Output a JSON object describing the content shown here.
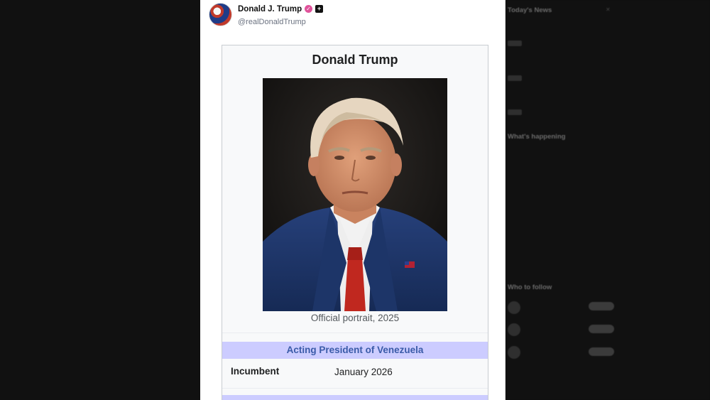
{
  "post": {
    "author": {
      "display_name": "Donald J. Trump",
      "handle": "@realDonaldTrump",
      "badge_icon": "verified-badge-icon",
      "badge_color": "#e0539b",
      "extra_icon": "plus-square-icon"
    },
    "infobox": {
      "title": "Donald Trump",
      "caption": "Official portrait, 2025",
      "office_title": "Acting President of Venezuela",
      "office_header_color": "#ccccff",
      "rows": [
        {
          "label": "Incumbent",
          "value": "January 2026"
        }
      ]
    }
  },
  "sidebar": {
    "sections": [
      {
        "heading": "Today's News"
      },
      {
        "heading": "What's happening"
      },
      {
        "heading": "Who to follow"
      }
    ]
  }
}
